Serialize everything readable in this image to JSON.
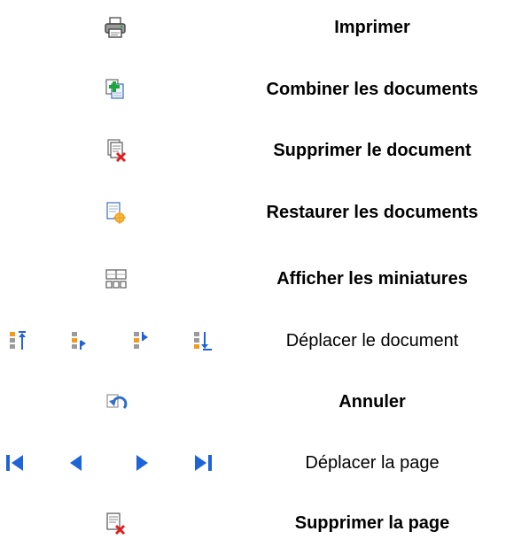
{
  "commands": [
    {
      "icon": "printer-icon",
      "label": "Imprimer"
    },
    {
      "icon": "combine-documents-icon",
      "label": "Combiner les documents"
    },
    {
      "icon": "delete-document-icon",
      "label": "Supprimer le document"
    },
    {
      "icon": "restore-documents-icon",
      "label": "Restaurer les documents"
    },
    {
      "icon": "thumbnails-icon",
      "label": "Afficher les miniatures"
    },
    {
      "icons": [
        "move-to-top-icon",
        "move-up-icon",
        "move-down-icon",
        "move-to-bottom-icon"
      ],
      "label": "Déplacer le document"
    },
    {
      "icon": "undo-icon",
      "label": "Annuler"
    },
    {
      "icons": [
        "first-page-icon",
        "previous-page-icon",
        "next-page-icon",
        "last-page-icon"
      ],
      "label": "Déplacer la page"
    },
    {
      "icon": "delete-page-icon",
      "label": "Supprimer la page"
    }
  ],
  "colors": {
    "nav_blue": "#1f63d8",
    "delete_red": "#e02020",
    "add_green": "#1ea53a",
    "highlight_orange": "#f39a1a",
    "undo_blue": "#2f6fc8"
  }
}
